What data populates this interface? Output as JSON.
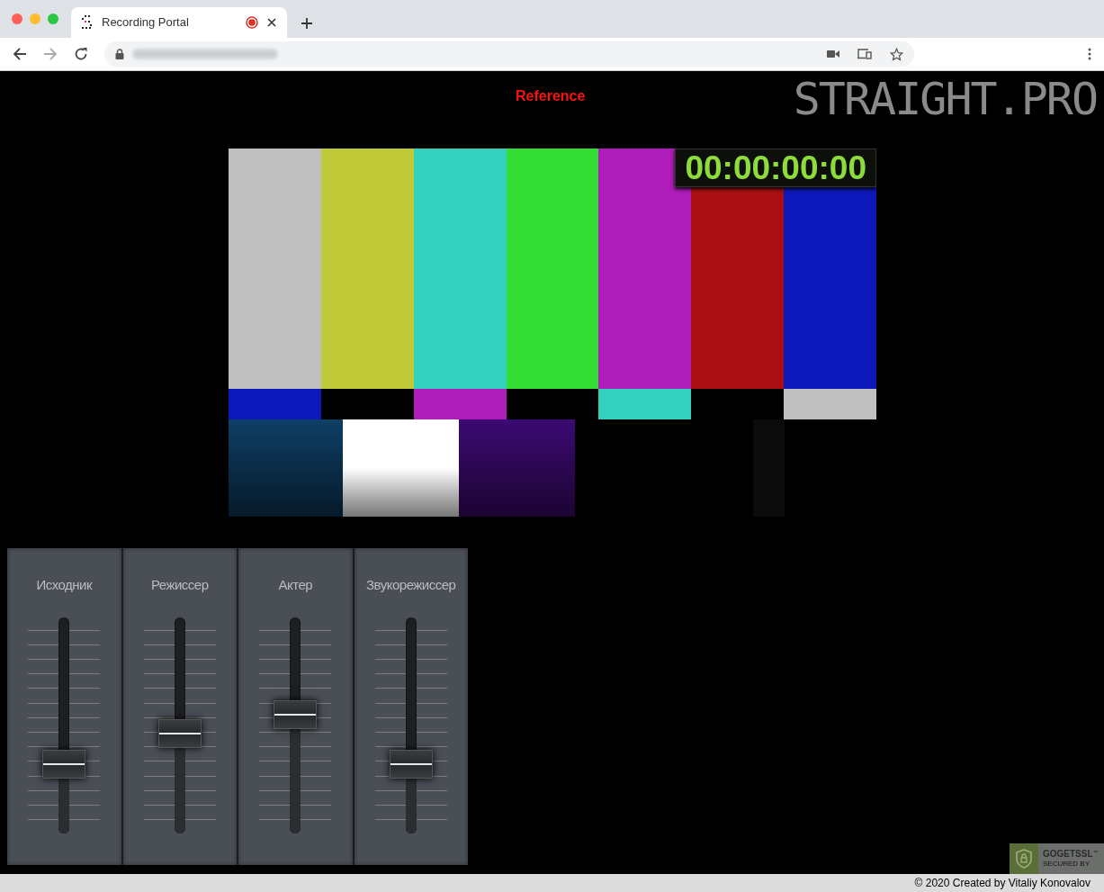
{
  "browser": {
    "tab_title": "Recording Portal",
    "recording": true
  },
  "page": {
    "heading": "Reference",
    "logo": "STRAIGHT.PRO"
  },
  "video": {
    "timecode": "00:00:00:00"
  },
  "mixer": {
    "channels": [
      {
        "name": "Исходник",
        "level": 0.32
      },
      {
        "name": "Режиссер",
        "level": 0.46
      },
      {
        "name": "Актер",
        "level": 0.55
      },
      {
        "name": "Звукорежиссер",
        "level": 0.32
      }
    ]
  },
  "ssl_badge": {
    "brand": "GOGETSSL",
    "trademark": "™",
    "caption": "SECURED BY"
  },
  "footer": "© 2020 Created by Vitaliy Konovalov"
}
